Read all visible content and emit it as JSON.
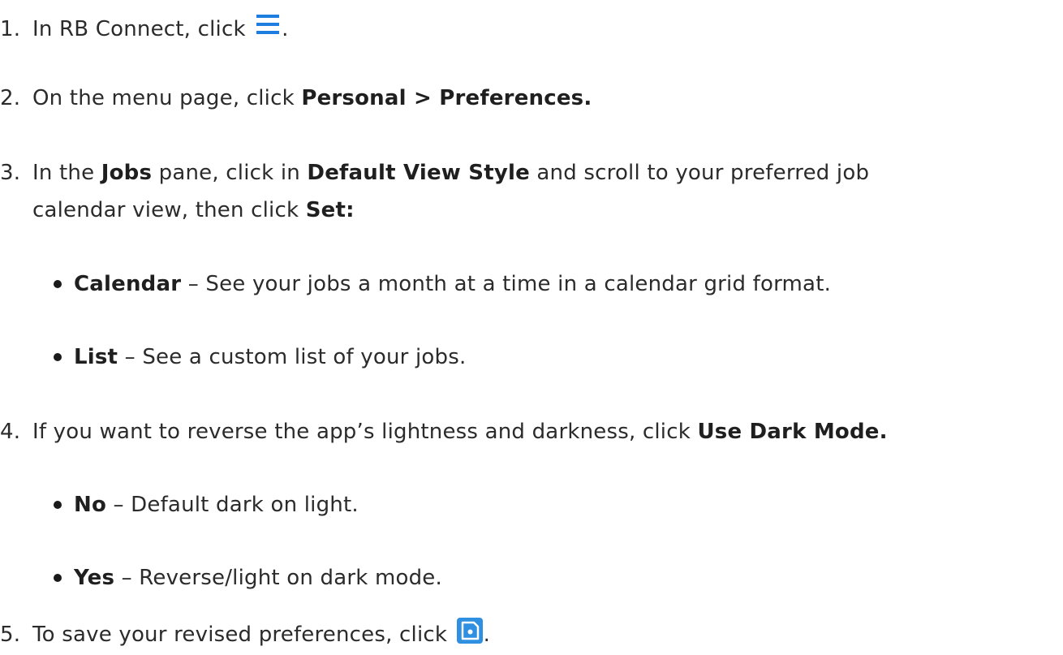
{
  "steps": [
    {
      "num": "1.",
      "pre": "In RB Connect, click ",
      "icon": "menu-icon",
      "post": "."
    },
    {
      "num": "2.",
      "pre": "On the menu page, click ",
      "bold": "Personal > Preferences."
    },
    {
      "num": "3.",
      "a": "In the ",
      "b1": "Jobs",
      "c": " pane, click in ",
      "b2": "Default View Style",
      "d": " and scroll to your preferred job",
      "line2_pre": "calendar view, then click ",
      "line2_bold": "Set:",
      "bullets": [
        {
          "bold": "Calendar",
          "text": " – See your jobs a month at a time in a calendar grid format."
        },
        {
          "bold": "List",
          "text": " – See a custom list of your jobs."
        }
      ]
    },
    {
      "num": "4.",
      "pre": "If you want to reverse the app’s lightness and darkness, click ",
      "bold": "Use Dark Mode.",
      "bullets": [
        {
          "bold": "No",
          "text": " – Default dark on light."
        },
        {
          "bold": "Yes",
          "text": " – Reverse/light on dark mode."
        }
      ]
    },
    {
      "num": "5.",
      "pre": "To save your revised preferences, click ",
      "icon": "save-icon",
      "post": "."
    }
  ],
  "colors": {
    "text": "#2b2b2b",
    "icon_blue": "#1e7ee0",
    "save_blue": "#2f8fe0"
  }
}
